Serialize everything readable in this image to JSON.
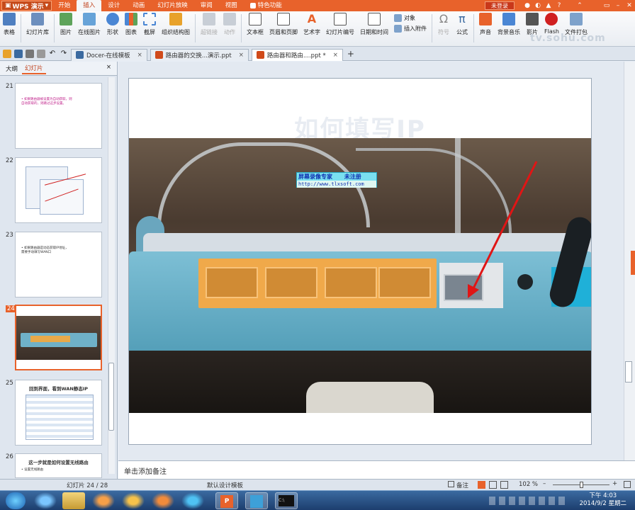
{
  "menubar": {
    "app_menu": "WPS 演示",
    "tabs": [
      "开始",
      "插入",
      "设计",
      "动画",
      "幻灯片放映",
      "审阅",
      "视图",
      "特色功能"
    ],
    "active_tab": "插入",
    "login_label": "未登录"
  },
  "ribbon": {
    "groups": [
      {
        "label": "表格"
      },
      {
        "label": "幻灯片库"
      },
      {
        "label": "图片"
      },
      {
        "label": "在线图片"
      },
      {
        "label": "形状"
      },
      {
        "label": "图表"
      },
      {
        "label": "截屏"
      },
      {
        "label": "组织结构图"
      },
      {
        "label": "超链接"
      },
      {
        "label": "动作"
      },
      {
        "label": "文本框"
      },
      {
        "label": "页眉和页脚"
      },
      {
        "label": "艺术字"
      },
      {
        "label": "幻灯片编号"
      },
      {
        "label": "日期和时间"
      }
    ],
    "stack_object": "对象",
    "stack_attach": "插入附件",
    "more": [
      {
        "label": "符号"
      },
      {
        "label": "公式"
      },
      {
        "label": "声音"
      },
      {
        "label": "背景音乐"
      },
      {
        "label": "影片"
      },
      {
        "label": "Flash"
      },
      {
        "label": "文件打包"
      }
    ],
    "watermark": "tv.sohu.com"
  },
  "doctabs": [
    {
      "label": "Docer-在线模板",
      "active": false
    },
    {
      "label": "路由器的交换...演示.ppt",
      "active": false
    },
    {
      "label": "路由器和路由....ppt *",
      "active": true
    }
  ],
  "leftpanel": {
    "tabs": [
      "大纲",
      "幻灯片"
    ],
    "active_tab": "幻灯片",
    "slides": [
      {
        "num": "21",
        "text": "• 如果路由器被设置为自动获取，则\n  自动获取的，则跳过这步设置。"
      },
      {
        "num": "22",
        "text": ""
      },
      {
        "num": "23",
        "text": "• 如果路由器是动态获取IP地址，\n  需要手动填写WAN口"
      },
      {
        "num": "24",
        "text": ""
      },
      {
        "num": "25",
        "text": "回到界面，看到WAN静态IP"
      },
      {
        "num": "26",
        "text": "这一步就是如何设置无线路由",
        "bullet": "• 设置无线路由"
      }
    ]
  },
  "slide": {
    "title": "如何填写IP",
    "overlay_line1": "屏幕录像专家      未注册",
    "overlay_line2": "http://www.tlxsoft.com"
  },
  "notes": {
    "placeholder": "单击添加备注"
  },
  "status": {
    "slide_count": "幻灯片 24 / 28",
    "template": "默认设计模板",
    "notes_label": "备注",
    "zoom": "102 %"
  },
  "taskbar": {
    "time": "下午 4:03",
    "date": "2014/9/2 星期二"
  },
  "colors": {
    "accent": "#e8622b",
    "selection": "#e8622b"
  }
}
